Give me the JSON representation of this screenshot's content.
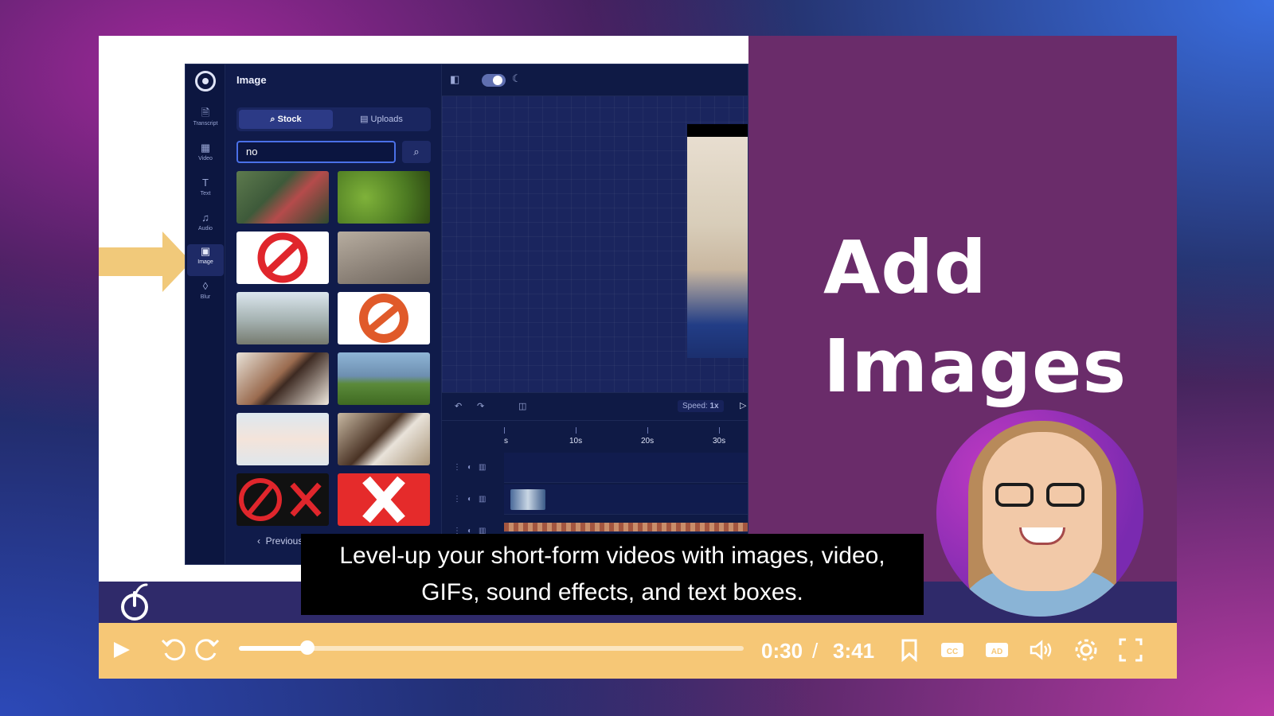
{
  "slide": {
    "headline_line1": "Add",
    "headline_line2": "Images"
  },
  "editor": {
    "panel_title": "Image",
    "rail": [
      {
        "label": "Transcript",
        "icon": "document-icon"
      },
      {
        "label": "Video",
        "icon": "film-icon"
      },
      {
        "label": "Text",
        "icon": "text-icon"
      },
      {
        "label": "Audio",
        "icon": "music-icon"
      },
      {
        "label": "Image",
        "icon": "image-icon"
      },
      {
        "label": "Blur",
        "icon": "drop-icon"
      }
    ],
    "tabs": {
      "stock": "Stock",
      "uploads": "Uploads"
    },
    "search_value": "no",
    "pagination_prev": "Previous",
    "speed_label": "Speed:",
    "speed_value": "1x",
    "ruler_labels": [
      "s",
      "10s",
      "20s",
      "30s"
    ]
  },
  "caption": {
    "line1": "Level-up your short-form videos with images, video,",
    "line2": "GIFs, sound effects, and text boxes."
  },
  "player": {
    "current_time": "0:30",
    "separator": "/",
    "duration": "3:41",
    "progress_fraction": 0.136,
    "colors": {
      "control_bar": "#f6c776",
      "slide_accent": "#6a2c6a",
      "arrow": "#f1c97a"
    }
  }
}
